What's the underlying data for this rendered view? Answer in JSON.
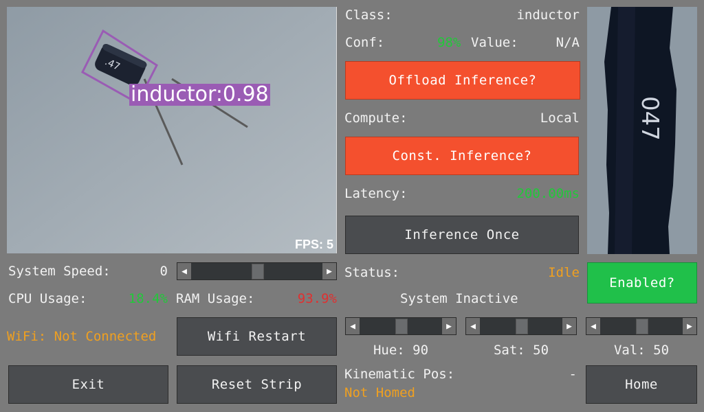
{
  "camera": {
    "detection_label": "inductor:0.98",
    "component_marking": ".47",
    "fps": "FPS: 5"
  },
  "side_image": {
    "marking": "047"
  },
  "classification": {
    "class_label": "Class:",
    "class_value": "inductor",
    "conf_label": "Conf:",
    "conf_value": "98%",
    "value_label": "Value:",
    "value_value": "N/A"
  },
  "buttons": {
    "offload": "Offload Inference?",
    "const": "Const. Inference?",
    "once": "Inference Once",
    "enabled": "Enabled?",
    "wifi_restart": "Wifi Restart",
    "exit": "Exit",
    "reset_strip": "Reset Strip",
    "home": "Home"
  },
  "compute": {
    "label": "Compute:",
    "value": "Local"
  },
  "latency": {
    "label": "Latency:",
    "value": "200.00ms"
  },
  "status": {
    "label": "Status:",
    "value": "Idle",
    "system": "System Inactive"
  },
  "system": {
    "speed_label": "System Speed:",
    "speed_value": "0",
    "speed_fraction": 0.5,
    "cpu_label": "CPU Usage:",
    "cpu_value": "18.4%",
    "ram_label": "RAM Usage:",
    "ram_value": "93.9%",
    "wifi_status": "WiFi: Not Connected"
  },
  "hsv": {
    "hue_label": "Hue: 90",
    "sat_label": "Sat: 50",
    "val_label": "Val: 50",
    "hue_fraction": 0.5,
    "sat_fraction": 0.5,
    "val_fraction": 0.5
  },
  "kinematic": {
    "label": "Kinematic Pos:",
    "value": "-",
    "state": "Not Homed"
  },
  "icons": {
    "slider_left": "◀",
    "slider_right": "▶"
  },
  "colors": {
    "background": "#7b7b7b",
    "red_button": "#f4502e",
    "green_button": "#20c04a",
    "good": "#22c83a",
    "warn": "#f0a020",
    "bad": "#e03030",
    "detection_box": "#9a5cb4"
  }
}
